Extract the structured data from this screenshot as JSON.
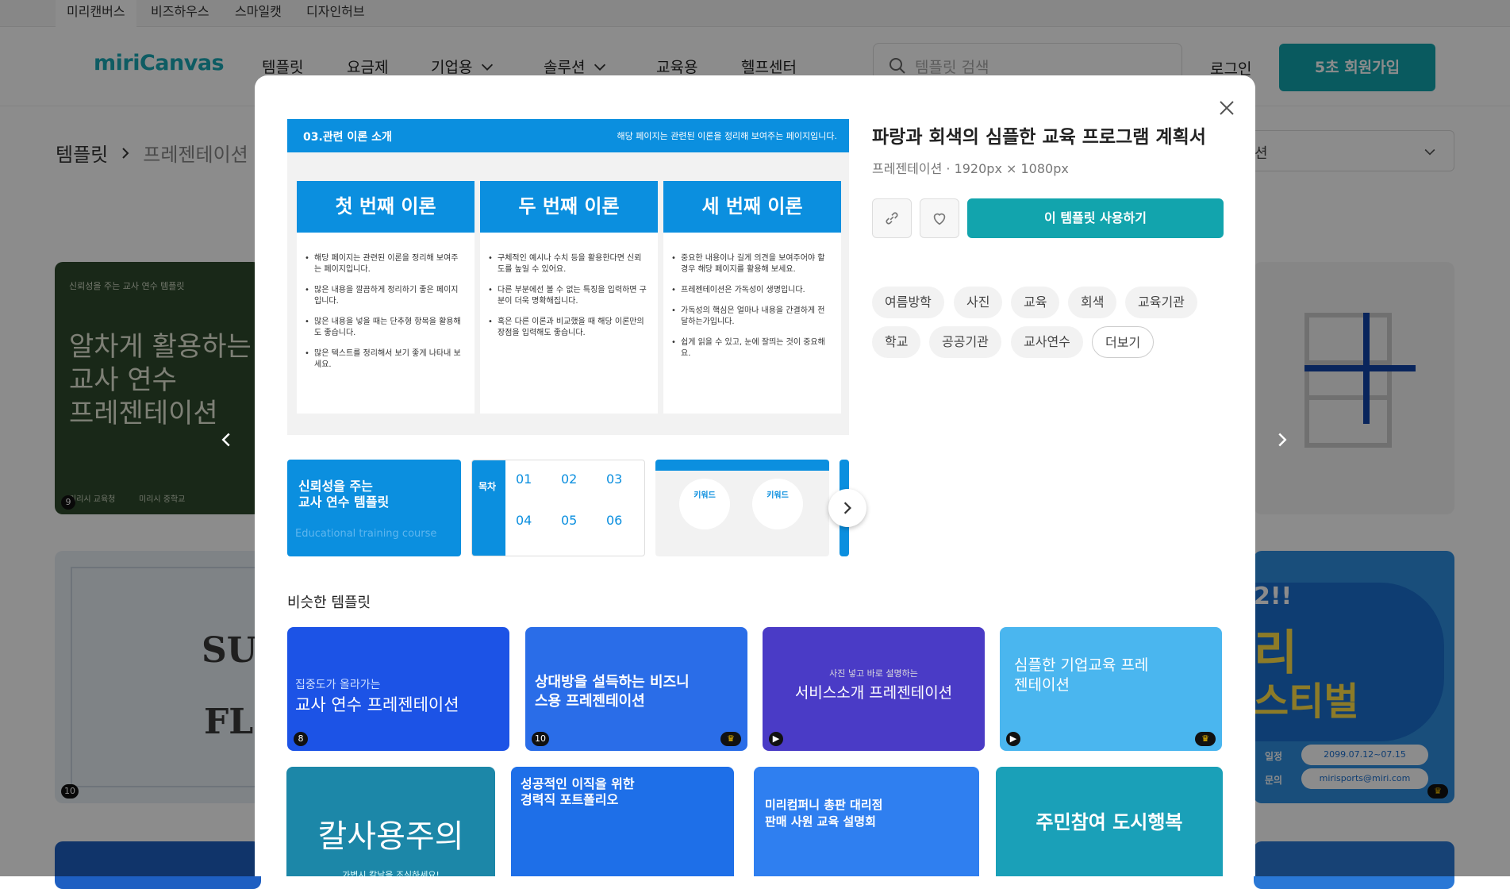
{
  "family_bar": [
    "미리캔버스",
    "비즈하우스",
    "스마일캣",
    "디자인허브"
  ],
  "header": {
    "logo": "miriCanvas",
    "nav": [
      "템플릿",
      "요금제",
      "기업용",
      "솔루션",
      "교육용",
      "헬프센터"
    ],
    "search_placeholder": "템플릿 검색",
    "login": "로그인",
    "signup": "5초 회원가입"
  },
  "breadcrumb": {
    "root": "템플릿",
    "current": "프레젠테이션"
  },
  "sort_partial": "션",
  "background_cards": {
    "card1_small": "신뢰성을 주는 교사 연수 템플릿",
    "card1_title": [
      "알차게 활용하는",
      "교사 연수",
      "프레젠테이션"
    ],
    "card1_footer": [
      "미리시 교육청",
      "미리시 중학교"
    ],
    "card1_count": "9",
    "card2_partial": [
      "SU",
      "FL"
    ],
    "card2_count": "10",
    "card3_partial": [
      "2!!",
      "리",
      "스티벌"
    ],
    "card3_info": [
      "2099.07.12~07.15",
      "mirisports@miri.com"
    ],
    "card3_labels": [
      "일정",
      "문의"
    ]
  },
  "modal": {
    "title": "파랑과 회색의 심플한 교육 프로그램 계획서",
    "subtitle": "프레젠테이션 · 1920px × 1080px",
    "use_button": "이 템플릿 사용하기",
    "tags": [
      "여름방학",
      "사진",
      "교육",
      "회색",
      "교육기관",
      "학교",
      "공공기관",
      "교사연수"
    ],
    "more": "더보기",
    "preview": {
      "header_left": "03.관련 이론 소개",
      "header_right": "해당 페이지는 관련된 이론을 정리해 보여주는 페이지입니다.",
      "columns": [
        {
          "title": "첫 번째 이론",
          "items": [
            "해당 페이지는 관련된 이론을 정리해 보여주는 페이지입니다.",
            "많은 내용을 깔끔하게 정리하기 좋은 페이지입니다.",
            "많은 내용을 넣을 때는 단추형 항목을 활용해도 좋습니다.",
            "많은 텍스트를 정리해서 보기 좋게 나타내 보세요."
          ]
        },
        {
          "title": "두 번째 이론",
          "items": [
            "구체적인 예시나 수치 등을 활용한다면 신뢰도를 높일 수 있어요.",
            "다른 부분에선 볼 수 없는 특징을 입력하면 구분이 더욱 명확해집니다.",
            "혹은 다른 이론과 비교했을 때 해당 이론만의 장점을 입력해도 좋습니다."
          ]
        },
        {
          "title": "세 번째 이론",
          "items": [
            "중요한 내용이나 길게 의견을 보여주어야 할 경우 해당 페이지를 활용해 보세요.",
            "프레젠테이션은 가독성이 생명입니다.",
            "가독성의 핵심은 얼마나 내용을 간결하게 전달하는가입니다.",
            "쉽게 읽을 수 있고, 눈에 잘띄는 것이 중요해요."
          ]
        }
      ]
    },
    "thumbs": {
      "t1": {
        "title": [
          "신뢰성을 주는",
          "교사 연수 템플릿"
        ],
        "en": "Educational training course"
      },
      "t2": {
        "label": "목차",
        "nums": [
          "01",
          "02",
          "03",
          "04",
          "05",
          "06"
        ]
      },
      "t3": {
        "k1": "키워드",
        "k2": "키워드"
      }
    },
    "similar_heading": "비슷한 템플릿",
    "similar": [
      {
        "sub": "집중도가 올라가는",
        "title": "교사 연수 프레젠테이션",
        "badge": "8"
      },
      {
        "title": "상대방을 설득하는 비즈니스용 프레젠테이션",
        "badge": "10"
      },
      {
        "sub": "사진 넣고 바로 설명하는",
        "title": "서비스소개 프레젠테이션"
      },
      {
        "title": "심플한 기업교육 프레젠테이션"
      },
      {
        "title": "칼사용주의",
        "sub": "가볍시 칼날을 조심하세요!"
      },
      {
        "title": "성공적인 이직을 위한 경력직 포트폴리오"
      },
      {
        "title": "미리컴퍼니 총판 대리점 판매 사원 교육 설명회"
      },
      {
        "title": "주민참여 도시행복"
      }
    ]
  }
}
